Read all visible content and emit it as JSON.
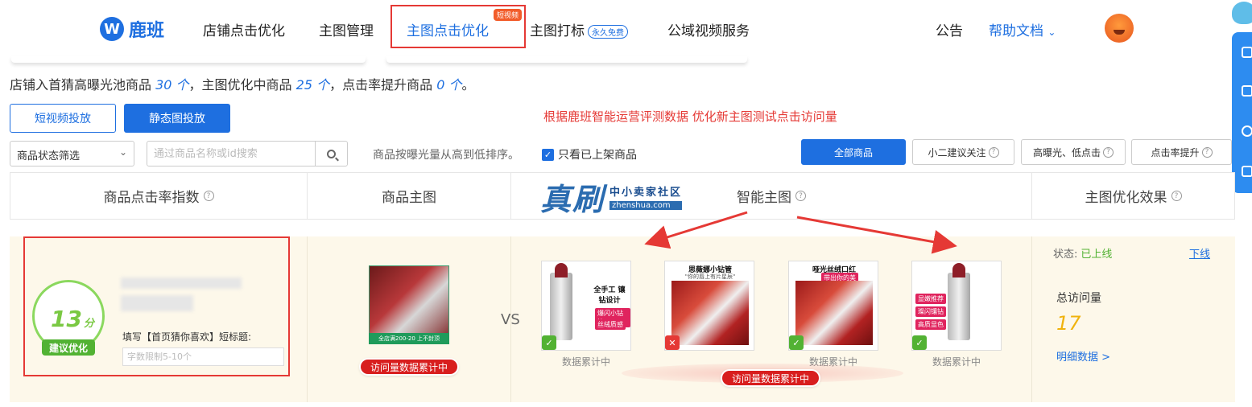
{
  "nav": {
    "logo": "鹿班",
    "items": [
      "店铺点击优化",
      "主图管理",
      "主图点击优化",
      "主图打标",
      "公域视频服务"
    ],
    "active_badge": "短视频",
    "free_tag": "永久免费",
    "notice": "公告",
    "help": "帮助文档"
  },
  "summary": {
    "p1": "店铺入首猜高曝光池商品 ",
    "n1": "30 个",
    "p2": "，主图优化中商品 ",
    "n2": "25 个",
    "p3": "，点击率提升商品 ",
    "n3": "0 个",
    "p4": "。"
  },
  "buttons": {
    "video": "短视频投放",
    "static": "静态图投放"
  },
  "red_note": "根据鹿班智能运营评测数据  优化新主图测试点击访问量",
  "filters": {
    "status_select": "商品状态筛选",
    "search_placeholder": "通过商品名称或id搜索",
    "sort_text": "商品按曝光量从高到低排序。",
    "only_listed": "只看已上架商品",
    "tabs": [
      "全部商品",
      "小二建议关注",
      "高曝光、低点击",
      "点击率提升"
    ]
  },
  "table": {
    "headers": [
      "商品点击率指数",
      "商品主图",
      "智能主图",
      "主图优化效果"
    ]
  },
  "watermark": {
    "big": "真刷",
    "cn": "中小卖家社区",
    "en": "zhenshua.com"
  },
  "row": {
    "score": "13",
    "score_unit": "分",
    "score_tag": "建议优化",
    "fill_label": "填写【首页猜你喜欢】短标题:",
    "short_placeholder": "字数限制5-10个",
    "main_img_band": "全店满200-20 上不封顶",
    "pill": "访问量数据累计中",
    "vs": "VS",
    "smart_images": [
      {
        "title": "全手工 镶钻设计",
        "chips": [
          "爆闪小钻管",
          "丝绒质感"
        ],
        "mark": "ok"
      },
      {
        "title": "思薇娜小钻管",
        "sub": "\"你的唇上有片星辰\"",
        "mark": "bad"
      },
      {
        "title": "哑光丝绒口红",
        "sub": "带出你的美",
        "mark": "ok"
      },
      {
        "title": "",
        "chips": [
          "显嫩推荐",
          "璨闪镶钻",
          "高质显色"
        ],
        "mark": "ok"
      }
    ],
    "accumulating": "数据累计中",
    "status_label": "状态:",
    "status_value": "已上线",
    "offline": "下线",
    "visits_label": "总访问量",
    "visits_value": "17",
    "detail_link": "明细数据 >"
  },
  "colors": {
    "brand": "#1e6fe0",
    "highlight_red": "#e53935",
    "good_green": "#52b233"
  }
}
